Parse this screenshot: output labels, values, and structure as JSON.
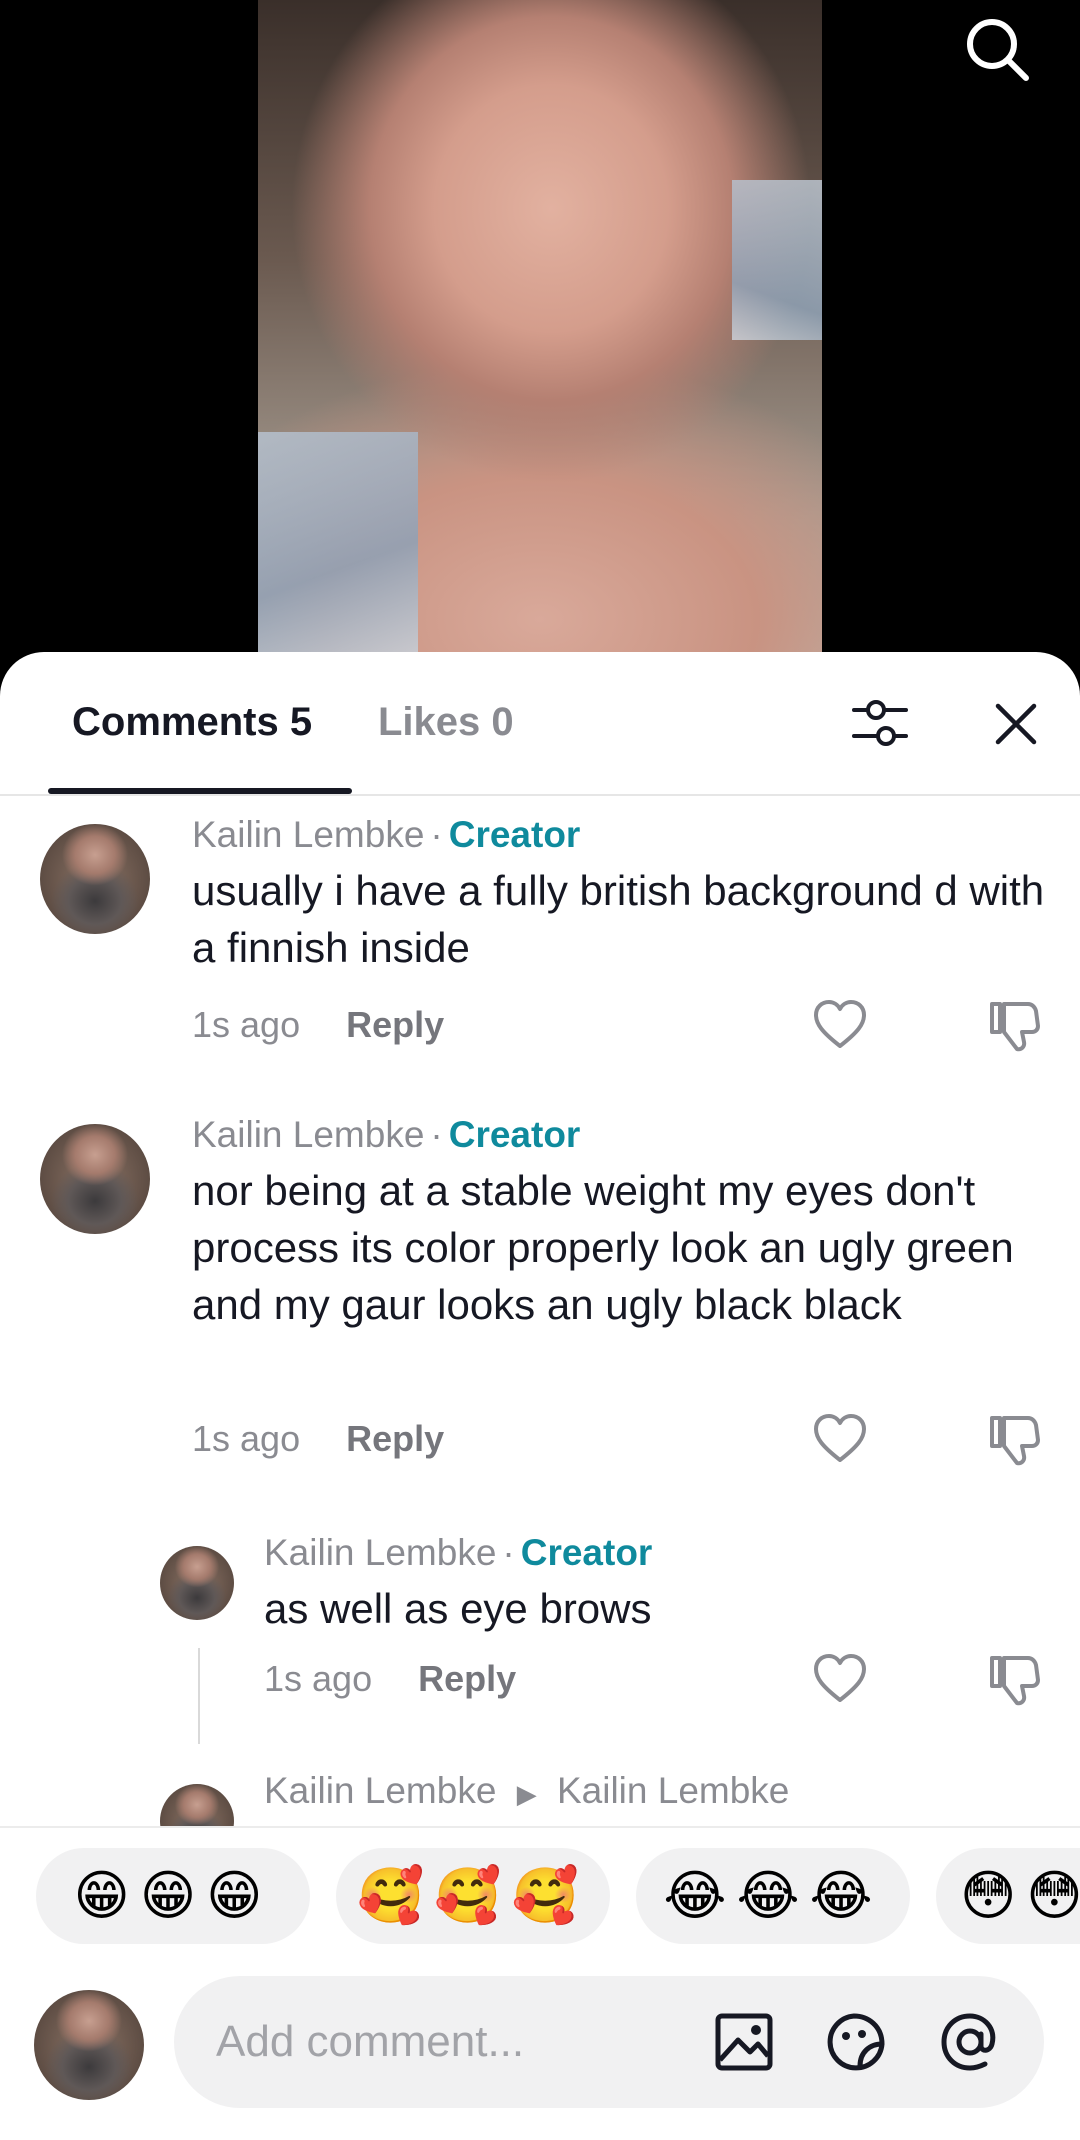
{
  "tabs": {
    "comments_label": "Comments 5",
    "likes_label": "Likes 0"
  },
  "comments": [
    {
      "author": "Kailin Lembke",
      "badge": "Creator",
      "text": "usually i have a fully british background d with a finnish inside",
      "time": "1s ago",
      "reply_label": "Reply"
    },
    {
      "author": "Kailin Lembke",
      "badge": "Creator",
      "text": "nor being at a stable weight my eyes don't process its color properly look an ugly green and my gaur looks an ugly black black",
      "time": "1s ago",
      "reply_label": "Reply"
    },
    {
      "author": "Kailin Lembke",
      "badge": "Creator",
      "text": "as well as eye brows",
      "time": "1s ago",
      "reply_label": "Reply"
    },
    {
      "author": "Kailin Lembke",
      "reply_to": "Kailin Lembke"
    }
  ],
  "emoji_quick": [
    "😁😁😁",
    "🥰🥰🥰",
    "😂😂😂",
    "😳😳"
  ],
  "composer": {
    "placeholder": "Add comment..."
  },
  "colors": {
    "creator_badge": "#0f8a9d",
    "text_primary": "#161823",
    "text_secondary": "#8a8b91",
    "input_bg": "#f1f1f2"
  },
  "icons": [
    "search-icon",
    "filter-icon",
    "close-icon",
    "heart-icon",
    "dislike-icon",
    "image-icon",
    "sticker-icon",
    "mention-icon"
  ]
}
